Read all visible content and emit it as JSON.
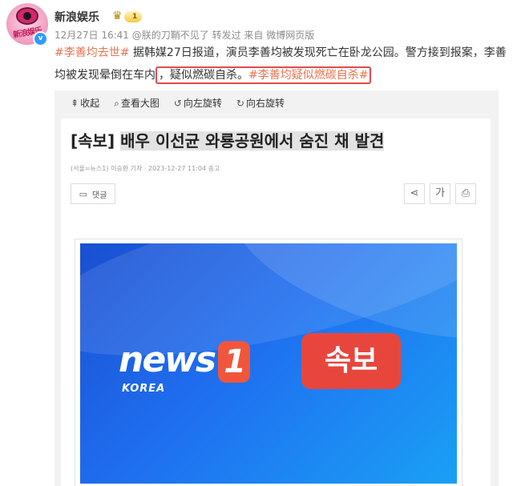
{
  "account": {
    "name": "新浪娱乐",
    "level": "1",
    "avatar_text": "新浪娱乐",
    "verified": "v",
    "meta": "12月27日 16:41 @朕的刀鞘不见了 转发过 来自 微博网页版"
  },
  "post": {
    "tag1": "#李善均去世#",
    "text1": " 据韩媒27日报道，演员李善均被发现死亡在卧龙公园。警方接到报案，李善均被发现晕倒在车内",
    "highlight_text": "，疑似燃碳自杀。",
    "tag2": "#李善均疑似燃碳自杀#"
  },
  "toolbar": {
    "collapse": "收起",
    "view_large": "查看大图",
    "rotate_left": "向左旋转",
    "rotate_right": "向右旋转"
  },
  "article": {
    "prefix": "[속보]",
    "headline": "배우 이선균 와룡공원에서 숨진 채 발견",
    "byline": "(서울=뉴스1) 이승환 기자  ·  2023-12-27 11:04 송고",
    "comment_label": "댓글",
    "font_button": "가"
  },
  "banner": {
    "logo_text": "news",
    "logo_num": "1",
    "logo_sub": "KOREA",
    "breaking": "속보"
  },
  "colors": {
    "tag": "#eb7350",
    "highlight_border": "#e04a4a",
    "verified": "#2f9bff",
    "banner_blue": "#1f6ff0",
    "breaking_red": "#e8463d"
  },
  "icons": {
    "collapse": "collapse-icon",
    "zoom": "search-icon",
    "rotate_left": "rotate-left-icon",
    "rotate_right": "rotate-right-icon",
    "share": "share-icon",
    "print": "print-icon",
    "comment": "comment-icon"
  }
}
